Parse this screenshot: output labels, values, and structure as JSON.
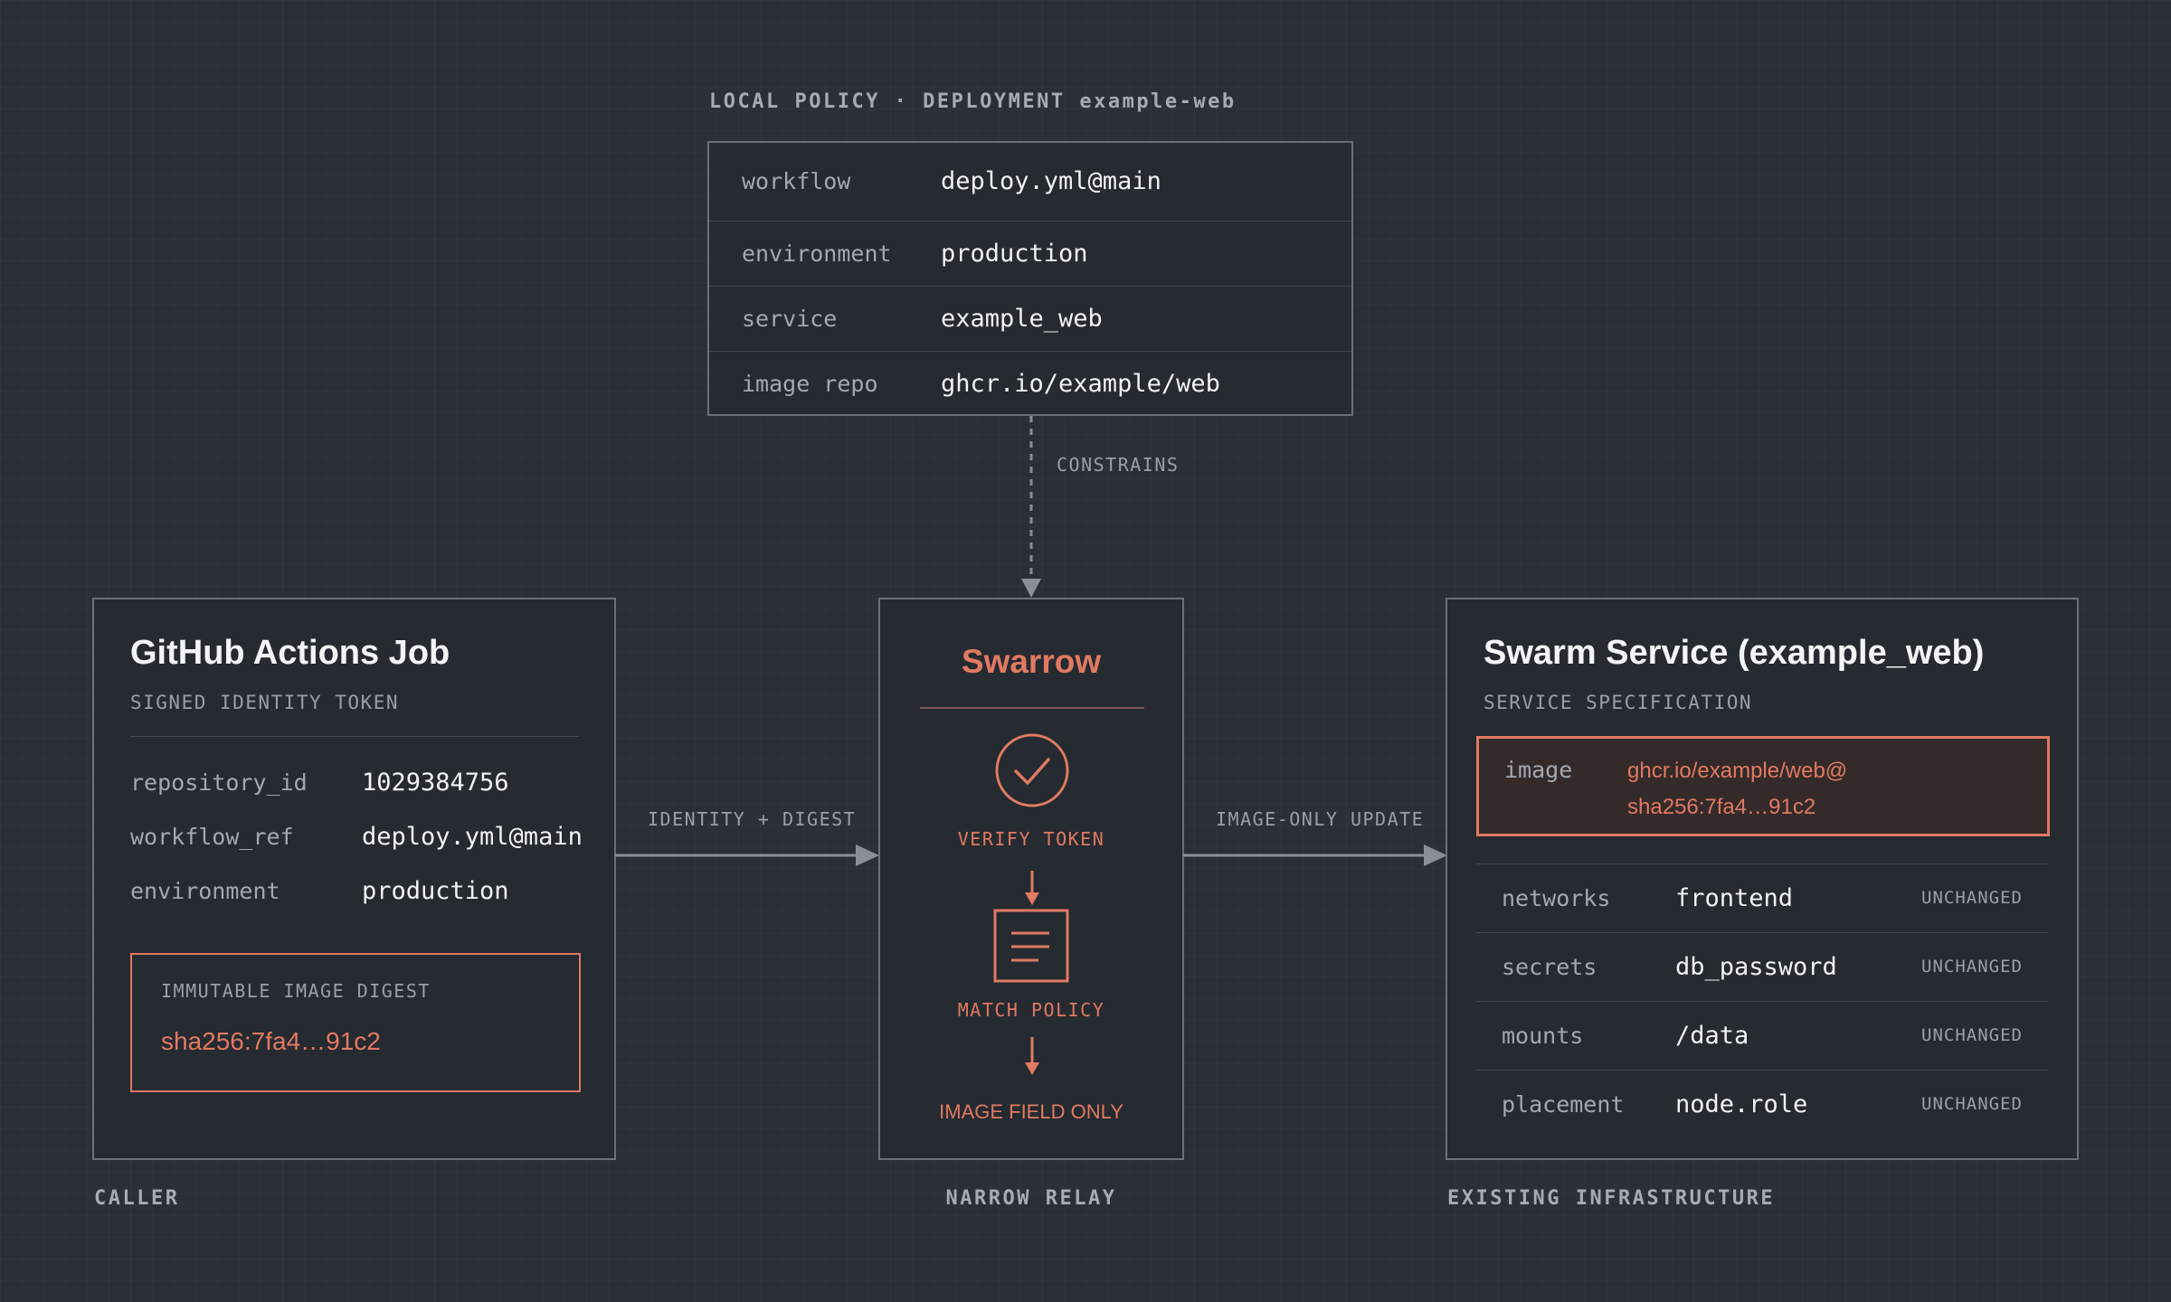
{
  "policy": {
    "heading": "LOCAL POLICY · DEPLOYMENT example-web",
    "rows": [
      {
        "key": "workflow",
        "value": "deploy.yml@main"
      },
      {
        "key": "environment",
        "value": "production"
      },
      {
        "key": "service",
        "value": "example_web"
      },
      {
        "key": "image repo",
        "value": "ghcr.io/example/web"
      }
    ],
    "edge_label": "CONSTRAINS"
  },
  "caller": {
    "title": "GitHub Actions Job",
    "subtitle": "SIGNED IDENTITY TOKEN",
    "rows": [
      {
        "key": "repository_id",
        "value": "1029384756"
      },
      {
        "key": "workflow_ref",
        "value": "deploy.yml@main"
      },
      {
        "key": "environment",
        "value": "production"
      }
    ],
    "digest_label": "IMMUTABLE IMAGE DIGEST",
    "digest_value": "sha256:7fa4…91c2",
    "footer": "CALLER"
  },
  "relay": {
    "title": "Swarrow",
    "step1": "VERIFY TOKEN",
    "step2": "MATCH POLICY",
    "step3": "IMAGE FIELD ONLY",
    "footer": "NARROW RELAY",
    "icons": [
      "check-circle-icon",
      "document-icon"
    ]
  },
  "edges": {
    "left": "IDENTITY + DIGEST",
    "right": "IMAGE-ONLY UPDATE"
  },
  "service": {
    "title": "Swarm Service (example_web)",
    "subtitle": "SERVICE SPECIFICATION",
    "image_key": "image",
    "image_value_line1": "ghcr.io/example/web@",
    "image_value_line2": "sha256:7fa4…91c2",
    "rows": [
      {
        "key": "networks",
        "value": "frontend",
        "status": "UNCHANGED"
      },
      {
        "key": "secrets",
        "value": "db_password",
        "status": "UNCHANGED"
      },
      {
        "key": "mounts",
        "value": "/data",
        "status": "UNCHANGED"
      },
      {
        "key": "placement",
        "value": "node.role",
        "status": "UNCHANGED"
      }
    ],
    "footer": "EXISTING INFRASTRUCTURE"
  },
  "colors": {
    "background": "#2b2f36",
    "panel": "#262a31",
    "border": "#6c7079",
    "accent": "#e07a62",
    "text": "#f1f2f4",
    "muted": "#a3a8b1"
  }
}
